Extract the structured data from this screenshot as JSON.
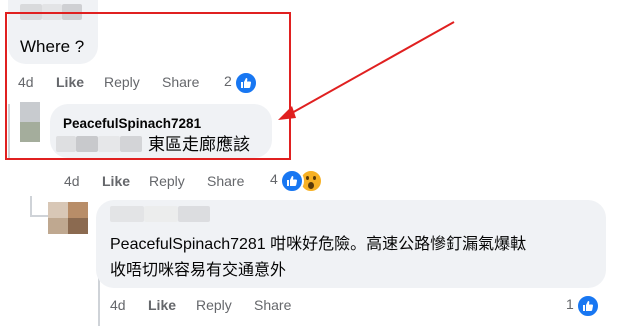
{
  "comments": [
    {
      "id": "c1",
      "author_blurred": true,
      "text": "Where ?",
      "time": "4d",
      "like_label": "Like",
      "reply_label": "Reply",
      "share_label": "Share",
      "reaction_count": "2",
      "reactions": [
        "like-icon"
      ]
    },
    {
      "id": "c2",
      "author": "PeacefulSpinach7281",
      "text": "東區走廊應該",
      "time": "4d",
      "like_label": "Like",
      "reply_label": "Reply",
      "share_label": "Share",
      "reaction_count": "4",
      "reactions": [
        "like-icon",
        "wow-icon"
      ]
    },
    {
      "id": "c3",
      "author_blurred": true,
      "text_line1": "PeacefulSpinach7281 咁咪好危險。高速公路慘釘漏氣爆軚",
      "text_line2": "收唔切咪容易有交通意外",
      "time": "4d",
      "like_label": "Like",
      "reply_label": "Reply",
      "share_label": "Share",
      "reaction_count": "1",
      "reactions": [
        "like-icon"
      ]
    }
  ],
  "colors": {
    "bubble": "#f0f2f5",
    "like_blue": "#1877f2",
    "annotation_red": "#e02020",
    "meta_gray": "#65676b"
  }
}
